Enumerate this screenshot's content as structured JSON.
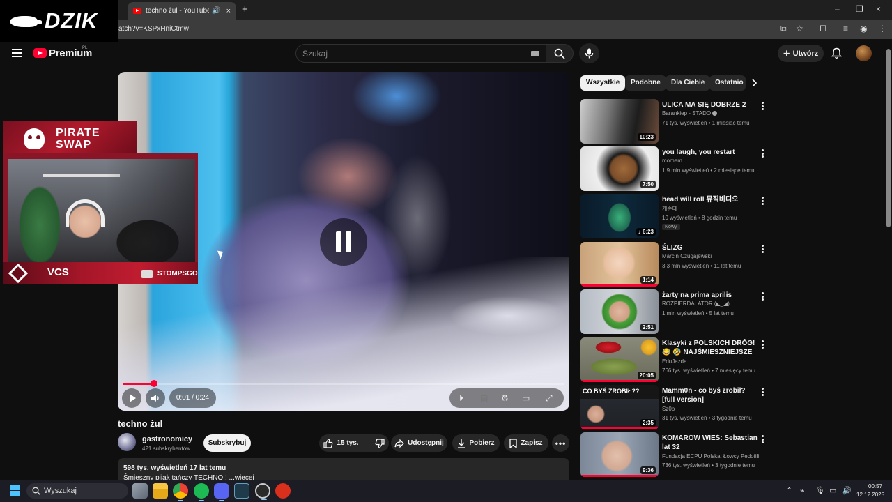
{
  "browser": {
    "tab_title": "techno żul - YouTube",
    "url": "atch?v=KSPxHniCtmw",
    "audio_icon": "speaker-icon",
    "close_icon": "×",
    "new_tab": "+",
    "window_controls": [
      "–",
      "❐",
      "×"
    ]
  },
  "overlay": {
    "brand": "DZIK",
    "sponsor_line1": "PIRATE",
    "sponsor_line2": "SWAP",
    "vcs_logo": "VCS",
    "streamer_name": "STOMPSGO"
  },
  "header": {
    "logo_text": "Premium",
    "region": "PL",
    "search_placeholder": "Szukaj",
    "create_label": "Utwórz"
  },
  "player": {
    "time": "0:01 / 0:24",
    "progress": 0.07
  },
  "video": {
    "title": "techno żul",
    "channel": "gastronomicy",
    "subscribers": "421 subskrybentów",
    "subscribe_label": "Subskrybuj",
    "likes": "15 tys.",
    "share_label": "Udostępnij",
    "download_label": "Pobierz",
    "save_label": "Zapisz",
    "stats": "598 tys. wyświetleń  17 lat temu",
    "description": "Śmieszny pijak tańczy TECHNO ! ...więcej"
  },
  "chips": [
    "Wszystkie",
    "Podobne",
    "Dla Ciebie",
    "Ostatnio"
  ],
  "recommendations": [
    {
      "title": "ULICA MA SIĘ DOBRZE 2",
      "channel": "Barankiep - STADO",
      "verified": true,
      "meta": "71 tys. wyświetleń • 1 miesiąc temu",
      "duration": "10:23",
      "watched": 0
    },
    {
      "title": "you laugh, you restart",
      "channel": "momem",
      "meta": "1,9 mln wyświetleń • 2 miesiące temu",
      "duration": "7:50",
      "watched": 0
    },
    {
      "title": "head will roll 뮤직비디오",
      "channel": "개준태",
      "meta": "10 wyświetleń • 8 godzin temu",
      "badge": "Nowy",
      "duration": "♪ 6:23",
      "watched": 0
    },
    {
      "title": "ŚLIZG",
      "channel": "Marcin Czugajewski",
      "meta": "3,3 mln wyświetleń • 11 lat temu",
      "duration": "1:14",
      "watched": 1
    },
    {
      "title": "żarty na prima aprilis",
      "channel": "ROZPIERDALATOR (◣_◢)",
      "meta": "1 mln wyświetleń • 5 lat temu",
      "duration": "2:51",
      "watched": 0
    },
    {
      "title": "Klasyki z POLSKICH DRÓG! 😂 🤣 NAJŚMIESZNIEJSZE Wpadk…",
      "channel": "EduJazda",
      "meta": "766 tys. wyświetleń • 7 miesięcy temu",
      "duration": "20:05",
      "watched": 1
    },
    {
      "title": "Mamm0n - co byś zrobił? [full version]",
      "channel": "Sz0p",
      "meta": "31 tys. wyświetleń • 3 tygodnie temu",
      "duration": "2:35",
      "watched": 1
    },
    {
      "title": "KOMARÓW WIEŚ: Sebastian lat 32",
      "channel": "Fundacja ECPU Polska: Łowcy Pedofili",
      "meta": "736 tys. wyświetleń • 3 tygodnie temu",
      "duration": "9:36",
      "watched": 1
    }
  ],
  "taskbar": {
    "search_label": "Wyszukaj",
    "time": "00:57",
    "date": "12.12.2025",
    "accent": "#4cc2ff"
  },
  "colors": {
    "yt_red": "#ff0033",
    "background": "#0f0f0f",
    "overlay_red": "#b11a2c"
  }
}
